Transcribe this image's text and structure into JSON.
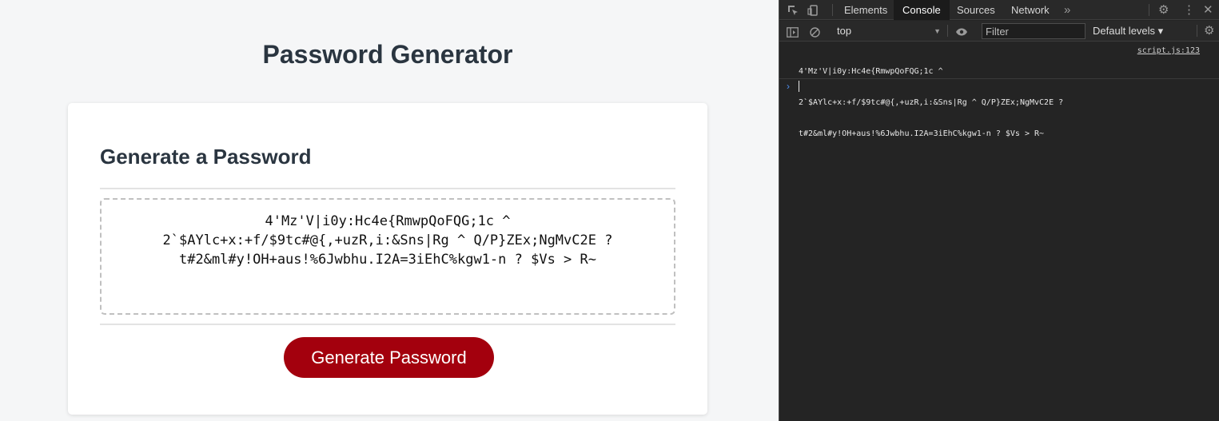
{
  "page": {
    "title": "Password Generator",
    "card_title": "Generate a Password",
    "password_lines": [
      "4'Mz'V|i0y:Hc4e{RmwpQoFQG;1c ^",
      "2`$AYlc+x:+f/$9tc#@{,+uzR,i:&Sns|Rg ^ Q/P}ZEx;NgMvC2E ?",
      "t#2&ml#y!OH+aus!%6Jwbhu.I2A=3iEhC%kgw1-n ? $Vs > R~"
    ],
    "generate_button": "Generate Password",
    "colors": {
      "button": "#a3000d",
      "heading": "#2a3540"
    }
  },
  "devtools": {
    "tabs": [
      {
        "label": "Elements",
        "active": false
      },
      {
        "label": "Console",
        "active": true
      },
      {
        "label": "Sources",
        "active": false
      },
      {
        "label": "Network",
        "active": false
      }
    ],
    "more_tabs_icon": "»",
    "context": "top",
    "filter_placeholder": "Filter",
    "levels": "Default levels ▾",
    "log": {
      "lines": [
        "4'Mz'V|i0y:Hc4e{RmwpQoFQG;1c ^",
        "2`$AYlc+x:+f/$9tc#@{,+uzR,i:&Sns|Rg ^ Q/P}ZEx;NgMvC2E ?",
        "t#2&ml#y!OH+aus!%6Jwbhu.I2A=3iEhC%kgw1-n ? $Vs > R~"
      ],
      "source": "script.js:123"
    },
    "prompt": "›"
  }
}
